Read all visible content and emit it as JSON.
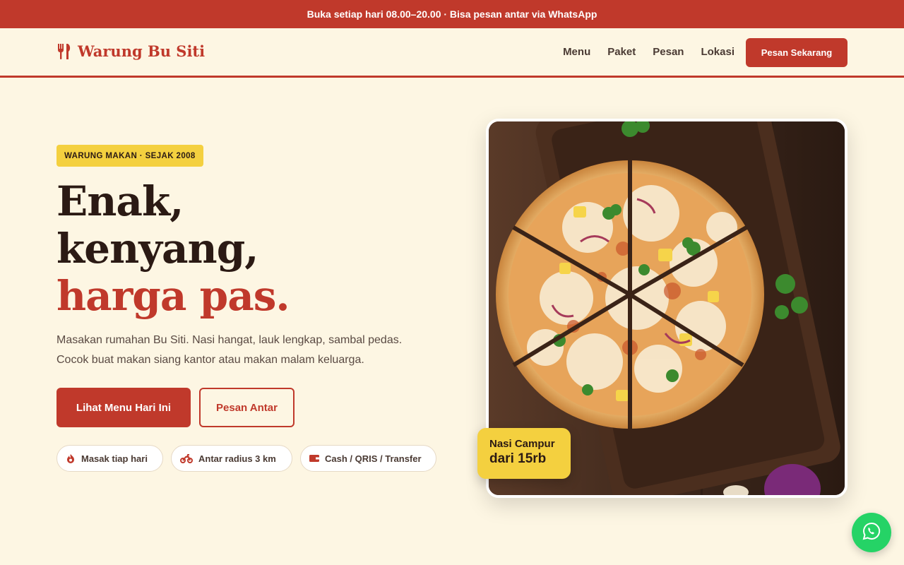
{
  "topbar": {
    "text": "Buka setiap hari 08.00–20.00 · Bisa pesan antar via WhatsApp"
  },
  "header": {
    "logo_text": "Warung Bu Siti",
    "nav": [
      "Menu",
      "Paket",
      "Pesan",
      "Lokasi"
    ],
    "cta_label": "Pesan Sekarang"
  },
  "hero": {
    "badge": "WARUNG MAKAN · SEJAK 2008",
    "headline_line1": "Enak,",
    "headline_line2": "kenyang,",
    "headline_line3": "harga pas.",
    "description_line1": "Masakan rumahan Bu Siti. Nasi hangat, lauk lengkap, sambal pedas.",
    "description_line2": "Cocok buat makan siang kantor atau makan malam keluarga.",
    "primary_button": "Lihat Menu Hari Ini",
    "secondary_button": "Pesan Antar",
    "chips": [
      {
        "label": "Masak tiap hari",
        "icon": "flame-icon"
      },
      {
        "label": "Antar radius 3 km",
        "icon": "motorcycle-icon"
      },
      {
        "label": "Cash / QRIS / Transfer",
        "icon": "wallet-icon"
      }
    ]
  },
  "promo": {
    "label": "Nasi Campur",
    "price": "dari 15rb"
  },
  "colors": {
    "primary": "#c0392b",
    "accent": "#f4d03f",
    "background": "#fdf6e3",
    "whatsapp": "#25d366"
  },
  "icons": {
    "logo": "fork-knife-icon",
    "floating": "whatsapp-icon",
    "photo": "pizza-photo"
  }
}
